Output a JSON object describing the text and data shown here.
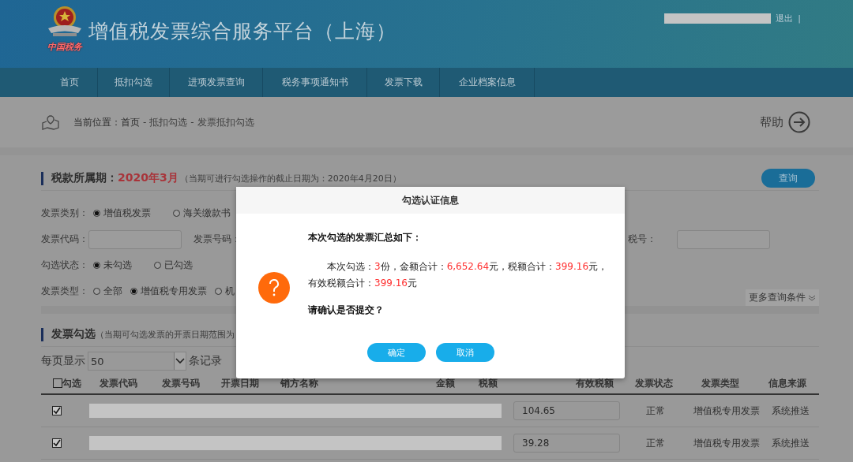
{
  "header": {
    "logo_text": "中国税务",
    "title": "增值税发票综合服务平台（上海）",
    "logout": "退出",
    "separator": "|"
  },
  "nav": [
    {
      "label": "首页",
      "selected": false
    },
    {
      "label": "抵扣勾选",
      "selected": false
    },
    {
      "label": "进项发票查询",
      "selected": false
    },
    {
      "label": "税务事项通知书",
      "selected": false
    },
    {
      "label": "发票下载",
      "selected": false
    },
    {
      "label": "企业档案信息",
      "selected": false
    }
  ],
  "breadcrumb": {
    "prefix": "当前位置：",
    "items": [
      "首页",
      "抵扣勾选",
      "发票抵扣勾选"
    ],
    "separator": "-",
    "help": "帮助"
  },
  "period": {
    "label": "税款所属期：",
    "value": "2020年3月",
    "note": "（当期可进行勾选操作的截止日期为：2020年4月20日）",
    "query_button": "查询"
  },
  "filters": [
    {
      "kind": "radios",
      "label": "发票类别：",
      "options": [
        {
          "label": "增值税发票",
          "selected": true
        },
        {
          "label": "海关缴款书",
          "selected": false
        }
      ]
    },
    {
      "kind": "fields",
      "label": "发票代码：",
      "label2": "发票号码：",
      "label3": "税号："
    },
    {
      "kind": "radios",
      "label": "勾选状态：",
      "options": [
        {
          "label": "未勾选",
          "selected": true
        },
        {
          "label": "已勾选",
          "selected": false
        }
      ]
    },
    {
      "kind": "radios",
      "label": "发票类型：",
      "options": [
        {
          "label": "全部",
          "selected": false
        },
        {
          "label": "增值税专用发票",
          "selected": true
        },
        {
          "label": "机",
          "selected": false
        }
      ]
    }
  ],
  "more_conditions": "更多查询条件",
  "section": {
    "title": "发票勾选",
    "note": "（当期可勾选发票的开票日期范围为",
    "per_page_label": "每页显示",
    "per_page": "50",
    "per_page_suffix": "条记录"
  },
  "table": {
    "select_all": {
      "label": "勾选",
      "checked": false
    },
    "columns": [
      "发票代码",
      "发票号码",
      "开票日期",
      "销方名称",
      "金额",
      "税额",
      "有效税额",
      "发票状态",
      "发票类型",
      "信息来源"
    ],
    "rows": [
      {
        "checked": true,
        "effective_tax": "104.65",
        "status": "正常",
        "type": "增值税专用发票",
        "source": "系统推送"
      },
      {
        "checked": true,
        "effective_tax": "39.28",
        "status": "正常",
        "type": "增值税专用发票",
        "source": "系统推送"
      }
    ]
  },
  "dialog": {
    "title": "勾选认证信息",
    "heading": "本次勾选的发票汇总如下：",
    "summary": [
      {
        "text": "本次勾选：",
        "highlight": false
      },
      {
        "text": "3",
        "highlight": true
      },
      {
        "text": "份，金额合计：",
        "highlight": false
      },
      {
        "text": "6,652.64",
        "highlight": true
      },
      {
        "text": "元，税额合计：",
        "highlight": false
      },
      {
        "text": "399.16",
        "highlight": true
      },
      {
        "text": "元，有效税额合计：",
        "highlight": false
      },
      {
        "text": "399.16",
        "highlight": true
      },
      {
        "text": "元",
        "highlight": false
      }
    ],
    "question": "请确认是否提交？",
    "buttons": [
      "确定",
      "取消"
    ]
  }
}
